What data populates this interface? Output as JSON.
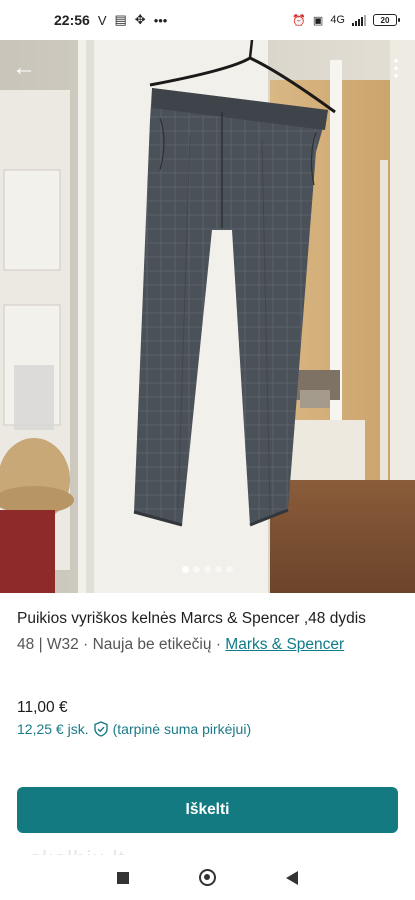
{
  "status_bar": {
    "time": "22:56",
    "battery": "20",
    "signal_label": "4G",
    "icons": [
      "v-icon",
      "calendar-icon",
      "grid-icon",
      "more-dots-icon",
      "alarm-icon",
      "volte-icon",
      "signal-icon",
      "battery-icon"
    ]
  },
  "gallery": {
    "image_count": 5,
    "active_index": 0
  },
  "listing": {
    "title": "Puikios  vyriškos kelnės Marcs & Spencer ,48 dydis",
    "size": "48",
    "separator": "|",
    "waist": "W32",
    "condition": "Nauja be etikečių",
    "brand": "Marks & Spencer",
    "price": "11,00 €",
    "price_incl": "12,25 € jsk.",
    "price_incl_note": "(tarpinė suma pirkėjui)"
  },
  "cta": {
    "label": "Iškelti"
  },
  "watermark": "skelbiu.lt",
  "colors": {
    "accent": "#137a82",
    "link": "#0e7c86"
  }
}
